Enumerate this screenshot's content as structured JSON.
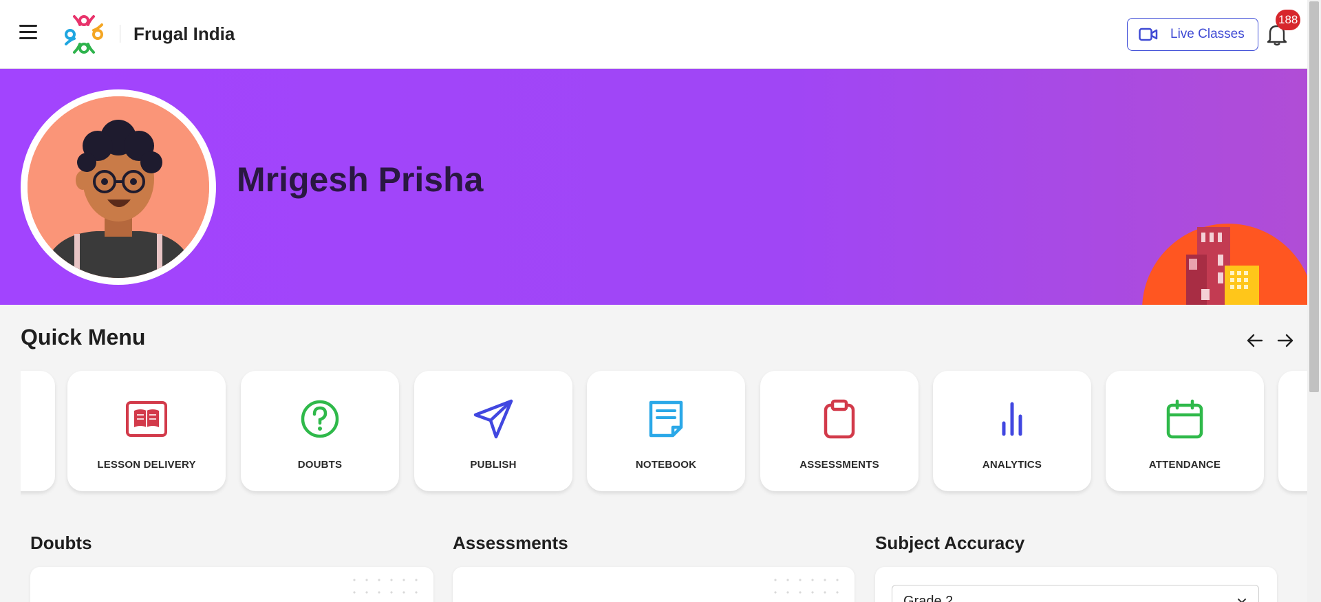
{
  "header": {
    "brand": "Frugal India",
    "live_classes_label": "Live Classes",
    "notification_count": "188"
  },
  "profile": {
    "name": "Mrigesh Prisha"
  },
  "quick_menu": {
    "title": "Quick Menu",
    "items": [
      {
        "label": "",
        "icon": "partial-card"
      },
      {
        "label": "LESSON DELIVERY",
        "icon": "book-icon",
        "color": "#d23a4a"
      },
      {
        "label": "DOUBTS",
        "icon": "question-icon",
        "color": "#2fb94a"
      },
      {
        "label": "PUBLISH",
        "icon": "send-icon",
        "color": "#4147e0"
      },
      {
        "label": "NOTEBOOK",
        "icon": "notebook-icon",
        "color": "#2aa8e8"
      },
      {
        "label": "ASSESSMENTS",
        "icon": "clipboard-icon",
        "color": "#d23a4a"
      },
      {
        "label": "ANALYTICS",
        "icon": "bar-chart-icon",
        "color": "#4147e0"
      },
      {
        "label": "ATTENDANCE",
        "icon": "calendar-icon",
        "color": "#2fb94a"
      }
    ]
  },
  "sections": {
    "doubts_title": "Doubts",
    "assessments_title": "Assessments",
    "subject_accuracy_title": "Subject Accuracy",
    "grade_select_value": "Grade 2"
  },
  "colors": {
    "banner": "#a244fe",
    "accent": "#4452d8",
    "badge": "#d7262c"
  }
}
